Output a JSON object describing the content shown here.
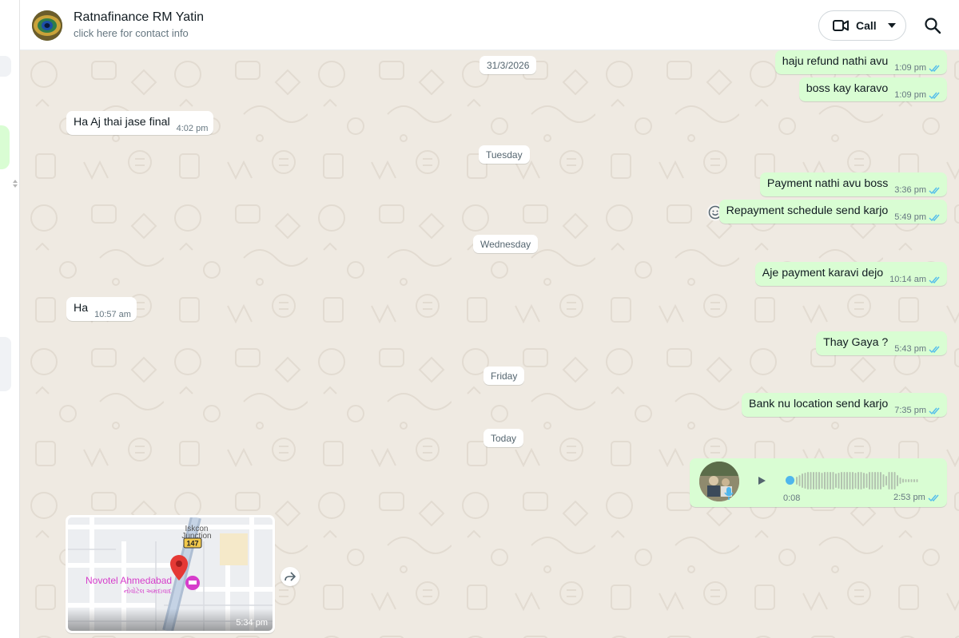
{
  "header": {
    "contact_name": "Ratnafinance RM Yatin",
    "contact_sub": "click here for contact info",
    "call_label": "Call",
    "icons": [
      "avatar",
      "video-call-icon",
      "chevron-down-icon",
      "search-icon"
    ]
  },
  "date_chips": {
    "d1": "31/3/2026",
    "d2": "Tuesday",
    "d3": "Wednesday",
    "d4": "Friday",
    "d5": "Today"
  },
  "messages": [
    {
      "dir": "out",
      "text": "haju refund nathi avu",
      "time": "1:09 pm",
      "status": "read"
    },
    {
      "dir": "out",
      "text": "boss kay karavo",
      "time": "1:09 pm",
      "status": "read"
    },
    {
      "dir": "in",
      "text": "Ha Aj thai jase final",
      "time": "4:02 pm"
    },
    {
      "dir": "out",
      "text": "Payment nathi avu boss",
      "time": "3:36 pm",
      "status": "read"
    },
    {
      "dir": "out",
      "text": "Repayment schedule send karjo",
      "time": "5:49 pm",
      "status": "read"
    },
    {
      "dir": "out",
      "text": "Aje payment karavi dejo",
      "time": "10:14 am",
      "status": "read"
    },
    {
      "dir": "in",
      "text": "Ha",
      "time": "10:57 am"
    },
    {
      "dir": "out",
      "text": "Thay Gaya ?",
      "time": "5:43 pm",
      "status": "read"
    },
    {
      "dir": "out",
      "text": "Bank nu location send karjo",
      "time": "7:35 pm",
      "status": "read"
    }
  ],
  "voice_note": {
    "duration": "0:08",
    "time": "2:53 pm",
    "status": "read",
    "progress": 0
  },
  "location": {
    "junction_label_1": "Iskcon",
    "junction_label_2": "Junction",
    "road_number": "147",
    "place_name": "Novotel Ahmedabad",
    "place_name_local": "નોવોટેલ અમદાવાદ",
    "time": "5:34 pm"
  },
  "colors": {
    "outgoing_bubble": "#d9fdd3",
    "incoming_bubble": "#ffffff",
    "chat_background": "#efeae2",
    "read_tick": "#53bdeb",
    "map_place": "#d63dcb",
    "map_pin": "#e53935"
  }
}
